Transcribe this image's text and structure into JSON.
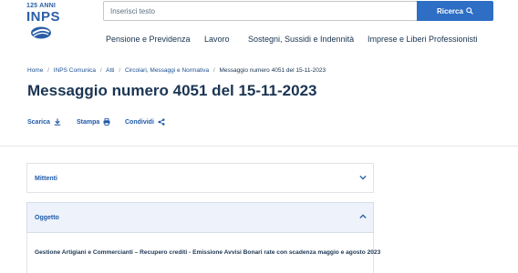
{
  "logo": {
    "years": "125 ANNI",
    "name": "INPS"
  },
  "search": {
    "placeholder": "Inserisci testo",
    "button_label": "Ricerca"
  },
  "nav": [
    {
      "label": "Pensione e Previdenza"
    },
    {
      "label": "Lavoro"
    },
    {
      "label": "Sostegni, Sussidi e Indennità"
    },
    {
      "label": "Imprese e Liberi Professionisti"
    }
  ],
  "breadcrumb": {
    "items": [
      "Home",
      "INPS Comunica",
      "Atti",
      "Circolari, Messaggi e Normativa"
    ],
    "separator": "/",
    "current": "Messaggio numero 4051 del 15-11-2023"
  },
  "page": {
    "title": "Messaggio numero 4051 del 15-11-2023"
  },
  "actions": [
    {
      "label": "Scarica",
      "icon": "download-icon"
    },
    {
      "label": "Stampa",
      "icon": "printer-icon"
    },
    {
      "label": "Condividi",
      "icon": "share-icon"
    }
  ],
  "accordions": {
    "mittenti": {
      "label": "Mittenti",
      "state": "collapsed"
    },
    "oggetto": {
      "label": "Oggetto",
      "state": "expanded",
      "body": "Gestione Artigiani e Commercianti – Recupero crediti - Emissione Avvisi Bonari rate con scadenza maggio e agosto 2023"
    }
  },
  "colors": {
    "brand_blue": "#2b5ea7",
    "button_blue": "#2e6ec4",
    "link_blue": "#1f5aa8",
    "text_dark": "#1b3553",
    "accordion_active_bg": "#edf2fb"
  }
}
